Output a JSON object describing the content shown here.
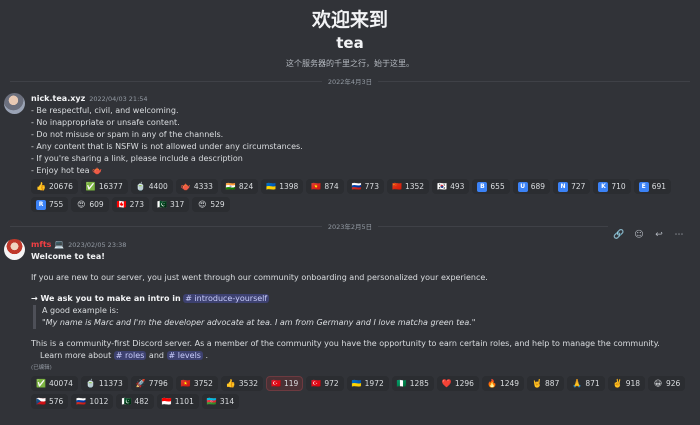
{
  "welcome": {
    "heading": "欢迎来到",
    "server_name": "tea",
    "subtitle": "这个服务器的千里之行，始于这里。"
  },
  "dividers": [
    "2022年4月3日",
    "2023年2月5日"
  ],
  "messages": [
    {
      "author": "nick.tea.xyz",
      "timestamp": "2022/04/03 21:54",
      "lines": [
        "- Be respectful, civil, and welcoming.",
        "- No inappropriate or unsafe content.",
        "- Do not misuse or spam in any of the channels.",
        "- Any content that is NSFW is not allowed under any circumstances.",
        "- If you're sharing a link, please include a description",
        "- Enjoy hot tea 🫖"
      ],
      "reactions": [
        {
          "emoji": "👍",
          "count": "20676",
          "color": ""
        },
        {
          "emoji": "✅",
          "count": "16377",
          "color": ""
        },
        {
          "emoji": "🍵",
          "count": "4400",
          "color": ""
        },
        {
          "emoji": "🫖",
          "count": "4333",
          "color": ""
        },
        {
          "emoji": "🇮🇳",
          "count": "824",
          "color": ""
        },
        {
          "emoji": "🇺🇦",
          "count": "1398",
          "color": ""
        },
        {
          "emoji": "🇻🇳",
          "count": "874",
          "color": ""
        },
        {
          "emoji": "🇷🇺",
          "count": "773",
          "color": ""
        },
        {
          "emoji": "🇨🇳",
          "count": "1352",
          "color": ""
        },
        {
          "emoji": "🇰🇷",
          "count": "493",
          "color": ""
        },
        {
          "emoji": "B",
          "count": "655",
          "color": "#3b82f6"
        },
        {
          "emoji": "U",
          "count": "689",
          "color": "#3b82f6"
        },
        {
          "emoji": "N",
          "count": "727",
          "color": "#3b82f6"
        },
        {
          "emoji": "K",
          "count": "710",
          "color": "#3b82f6"
        },
        {
          "emoji": "E",
          "count": "691",
          "color": "#3b82f6"
        },
        {
          "emoji": "R",
          "count": "755",
          "color": "#3b82f6"
        },
        {
          "emoji": "😍",
          "count": "609",
          "color": ""
        },
        {
          "emoji": "🇨🇦",
          "count": "273",
          "color": ""
        },
        {
          "emoji": "🇵🇰",
          "count": "317",
          "color": ""
        },
        {
          "emoji": "😍",
          "count": "529",
          "color": ""
        }
      ]
    },
    {
      "author": "mfts 💻",
      "timestamp": "2023/02/05 23:38",
      "title": "Welcome to tea!",
      "intro": "If you are new to our server, you just went through our community onboarding and personalized your experience.",
      "ask_prefix": "→ We ask you to make an intro in",
      "ask_channel": "# introduce-yourself",
      "example_label": "A good example is:",
      "example_quote": "\"My name is Marc and I'm the developer advocate at tea. I am from Germany and I love matcha green tea.\"",
      "community": "This is a community-first Discord server. As a member of the community you have the opportunity to earn certain roles, and help to manage the community.",
      "learn_prefix": "Learn more about",
      "learn_ch1": "# roles",
      "learn_and": "and",
      "learn_ch2": "# levels",
      "learn_suffix": ".",
      "edited": "(已编辑)",
      "reactions": [
        {
          "emoji": "✅",
          "count": "40074",
          "state": ""
        },
        {
          "emoji": "🍵",
          "count": "11373",
          "state": ""
        },
        {
          "emoji": "🚀",
          "count": "7796",
          "state": ""
        },
        {
          "emoji": "🇻🇳",
          "count": "3752",
          "state": ""
        },
        {
          "emoji": "👍",
          "count": "3532",
          "state": ""
        },
        {
          "emoji": "🇹🇷",
          "count": "119",
          "state": "hl"
        },
        {
          "emoji": "🇹🇷",
          "count": "972",
          "state": ""
        },
        {
          "emoji": "🇺🇦",
          "count": "1972",
          "state": ""
        },
        {
          "emoji": "🇳🇬",
          "count": "1285",
          "state": ""
        },
        {
          "emoji": "❤️",
          "count": "1296",
          "state": ""
        },
        {
          "emoji": "🔥",
          "count": "1249",
          "state": ""
        },
        {
          "emoji": "🤘",
          "count": "887",
          "state": ""
        },
        {
          "emoji": "🙏",
          "count": "871",
          "state": ""
        },
        {
          "emoji": "✌️",
          "count": "918",
          "state": ""
        },
        {
          "emoji": "😀",
          "count": "926",
          "state": ""
        },
        {
          "emoji": "🇨🇿",
          "count": "576",
          "state": ""
        },
        {
          "emoji": "🇷🇺",
          "count": "1012",
          "state": ""
        },
        {
          "emoji": "🇵🇰",
          "count": "482",
          "state": ""
        },
        {
          "emoji": "🇮🇩",
          "count": "1101",
          "state": ""
        },
        {
          "emoji": "🇦🇿",
          "count": "314",
          "state": ""
        }
      ]
    }
  ]
}
